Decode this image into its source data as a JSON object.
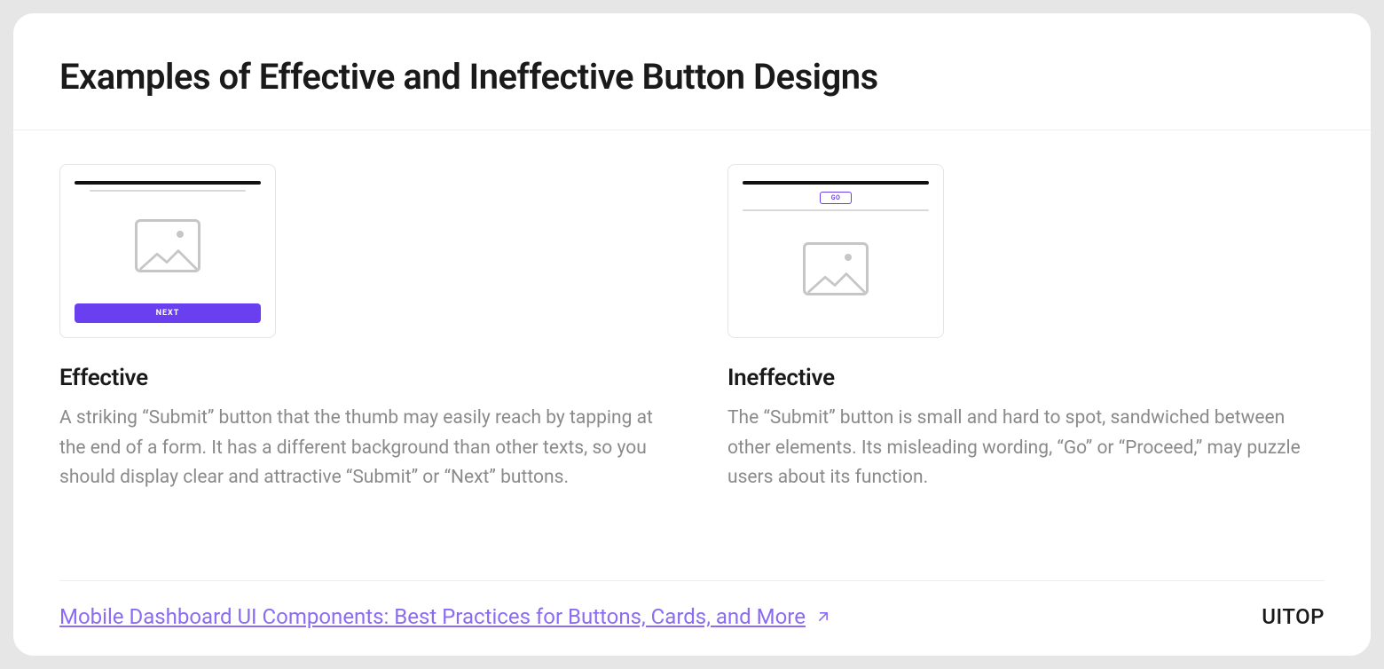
{
  "header": {
    "title": "Examples of Effective and Ineffective Button Designs"
  },
  "columns": [
    {
      "mockup_button_label": "NEXT",
      "heading": "Effective",
      "body": "A striking “Submit” button that the thumb may easily reach by tapping at the end of a form. It has a different background than other texts, so you should display clear and attractive “Submit” or “Next” buttons."
    },
    {
      "mockup_button_label": "GO",
      "heading": "Ineffective",
      "body": "The “Submit” button is small and hard to spot, sandwiched between other elements. Its misleading wording, “Go” or “Proceed,” may puzzle users about its function."
    }
  ],
  "footer": {
    "link_text": "Mobile Dashboard UI Components: Best Practices for Buttons, Cards, and More",
    "brand": "UITOP"
  },
  "colors": {
    "accent": "#6a3ff0",
    "link": "#8a6cf2",
    "text": "#1a1a1a",
    "muted": "#8a8a8a"
  }
}
